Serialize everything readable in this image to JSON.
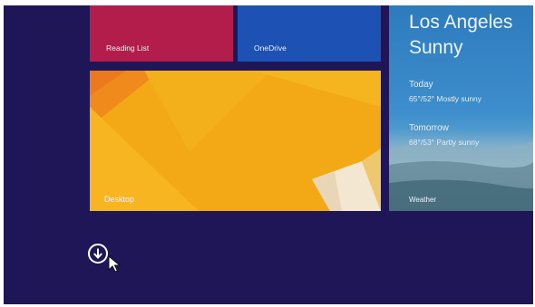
{
  "tiles": {
    "reading_list": {
      "label": "Reading List",
      "color": "#b21d4b"
    },
    "onedrive": {
      "label": "OneDrive",
      "color": "#1d51b3"
    },
    "desktop": {
      "label": "Desktop",
      "color": "#f3ab17"
    },
    "weather": {
      "city": "Los Angeles",
      "condition": "Sunny",
      "today_label": "Today",
      "today_forecast": "65°/52° Mostly sunny",
      "tomorrow_label": "Tomorrow",
      "tomorrow_forecast": "68°/53° Partly sunny",
      "app_label": "Weather"
    }
  },
  "apps_button": {
    "icon": "down-arrow-circle-icon"
  },
  "background_color": "#1e1656"
}
